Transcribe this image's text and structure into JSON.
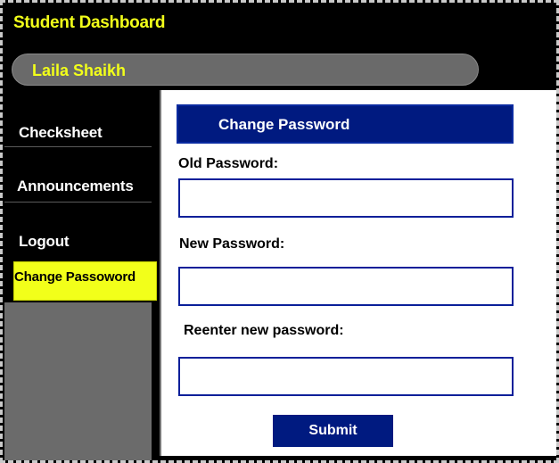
{
  "header": {
    "title": "Student Dashboard",
    "user_name": "Laila Shaikh"
  },
  "sidebar": {
    "items": [
      {
        "label": "Checksheet"
      },
      {
        "label": "Announcements"
      },
      {
        "label": "Logout"
      },
      {
        "label": "Change Passoword",
        "active": true
      }
    ]
  },
  "form": {
    "title": "Change Password",
    "old_label": "Old Password:",
    "old_value": "",
    "new_label": "New Password:",
    "new_value": "",
    "reenter_label": "Reenter new password:",
    "reenter_value": "",
    "submit_label": "Submit"
  },
  "colors": {
    "accent_yellow": "#f2ff1a",
    "navy": "#001a80",
    "background": "#000000",
    "sidebar_gray": "#6b6b6b"
  }
}
